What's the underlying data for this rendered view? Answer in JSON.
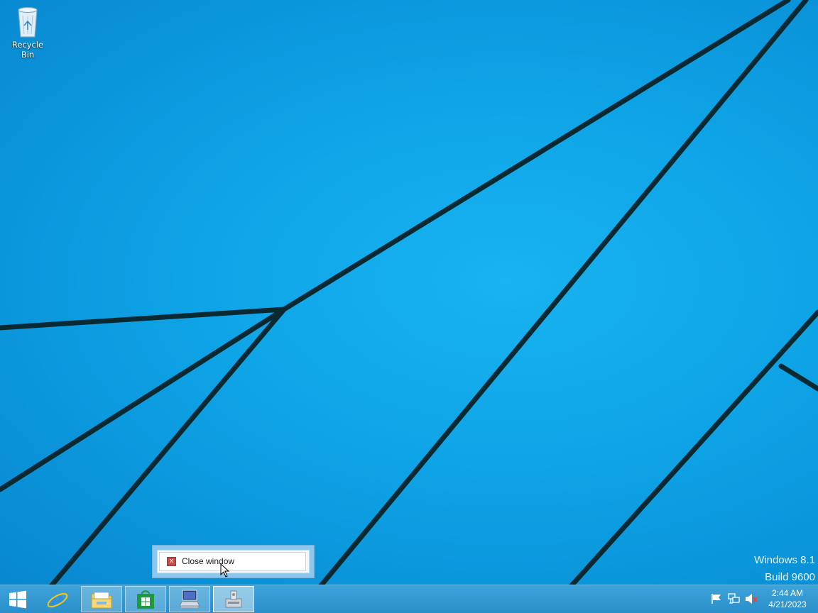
{
  "desktop": {
    "icons": [
      {
        "label": "Recycle Bin",
        "icon": "recycle-bin-icon"
      }
    ],
    "watermark": {
      "line1": "Windows 8.1",
      "line2": "Build 9600"
    }
  },
  "jumplist": {
    "items": [
      {
        "label": "Close window",
        "icon": "close-icon"
      }
    ]
  },
  "taskbar": {
    "buttons": [
      {
        "name": "start",
        "icon": "windows-logo-icon"
      },
      {
        "name": "internet-explorer",
        "icon": "ie-icon"
      },
      {
        "name": "file-explorer",
        "icon": "folder-icon"
      },
      {
        "name": "store",
        "icon": "store-icon"
      },
      {
        "name": "remote-desktop",
        "icon": "computer-icon"
      },
      {
        "name": "device",
        "icon": "device-icon"
      }
    ],
    "tray": {
      "icons": [
        "action-center-flag-icon",
        "network-icon",
        "volume-muted-icon"
      ],
      "time": "2:44 AM",
      "date": "4/21/2023"
    }
  },
  "colors": {
    "wallpaper": "#0ea3e6",
    "taskbar": "#2a8fcb",
    "close_icon": "#c74b4b"
  }
}
